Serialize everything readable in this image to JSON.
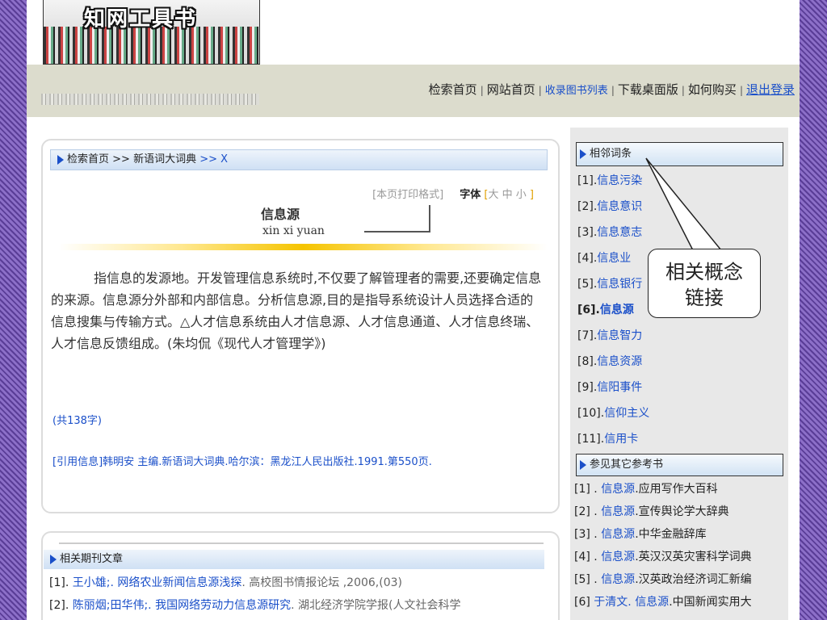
{
  "logo_title": "知网工具书",
  "nav": {
    "items": [
      {
        "label": "检索首页",
        "style": "normal"
      },
      {
        "label": "网站首页",
        "style": "normal"
      },
      {
        "label": "收录图书列表",
        "style": "blue"
      },
      {
        "label": "下载桌面版",
        "style": "normal"
      },
      {
        "label": "如何购买",
        "style": "normal"
      },
      {
        "label": "退出登录",
        "style": "underline"
      }
    ],
    "separator": "|"
  },
  "breadcrumb": {
    "home": "检索首页",
    "sep1": " >> ",
    "dict": "新语词大词典",
    "tail": " >> X"
  },
  "tools": {
    "print": "[本页打印格式]",
    "font_label": "字体",
    "open": "[",
    "large": "大",
    "medium": "中",
    "small": "小",
    "close": "]"
  },
  "entry": {
    "title": "信息源",
    "pinyin": "xin xi yuan",
    "body": "指信息的发源地。开发管理信息系统时,不仅要了解管理者的需要,还要确定信息的来源。信息源分外部和内部信息。分析信息源,目的是指导系统设计人员选择合适的信息搜集与传输方式。△人才信息系统由人才信息源、人才信息通道、人才信息终瑞、人才信息反馈组成。(朱均侃《现代人才管理学》)",
    "count": "(共138字)",
    "citation": "[引用信息]韩明安 主编.新语词大词典.哈尔滨：黑龙江人民出版社.1991.第550页."
  },
  "sidebar": {
    "related_heading": "相邻词条",
    "related": [
      {
        "num": "[1].",
        "label": "信息污染"
      },
      {
        "num": "[2].",
        "label": "信息意识"
      },
      {
        "num": "[3].",
        "label": "信息意志"
      },
      {
        "num": "[4].",
        "label": "信息业"
      },
      {
        "num": "[5].",
        "label": "信息银行"
      },
      {
        "num": "[6].",
        "label": "信息源"
      },
      {
        "num": "[7].",
        "label": "信息智力"
      },
      {
        "num": "[8].",
        "label": "信息资源"
      },
      {
        "num": "[9].",
        "label": "信阳事件"
      },
      {
        "num": "[10].",
        "label": "信仰主义"
      },
      {
        "num": "[11].",
        "label": "信用卡"
      }
    ],
    "refs_heading": "参见其它参考书",
    "refs": [
      {
        "num": "[1] . ",
        "pre": "",
        "term": "信息源",
        "book": ".应用写作大百科"
      },
      {
        "num": "[2] . ",
        "pre": "",
        "term": "信息源",
        "book": ".宣传舆论学大辞典"
      },
      {
        "num": "[3] . ",
        "pre": "",
        "term": "信息源",
        "book": ".中华金融辞库"
      },
      {
        "num": "[4] . ",
        "pre": "",
        "term": "信息源",
        "book": ".英汉汉英灾害科学词典"
      },
      {
        "num": "[5] . ",
        "pre": "",
        "term": "信息源",
        "book": ".汉英政治经济词汇新编"
      },
      {
        "num": "[6] ",
        "pre": "于清文. ",
        "term": "信息源",
        "book": ".中国新闻实用大"
      }
    ]
  },
  "callout": {
    "line1": "相关概念",
    "line2": "链接"
  },
  "journals": {
    "heading": "相关期刊文章",
    "items": [
      {
        "num": "[1]. ",
        "link": "王小雄;. 网络农业新闻信息源浅探",
        "source": ". 高校图书情报论坛 ,2006,(03)"
      },
      {
        "num": "[2]. ",
        "link": "陈丽烟;田华伟;. 我国网络劳动力信息源研究",
        "source": ". 湖北经济学院学报(人文社会科学"
      }
    ]
  },
  "colors": {
    "accent_blue": "#1a4fc9",
    "gold": "#f5c400",
    "frame_purple": "#6b4fae"
  }
}
